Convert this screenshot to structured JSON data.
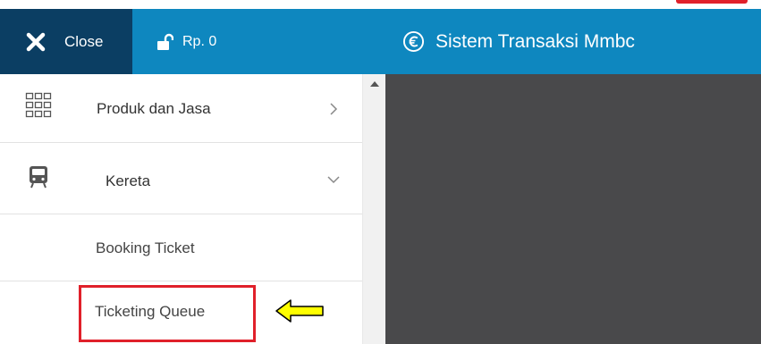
{
  "header": {
    "close_label": "Close",
    "balance_label": "Rp. 0",
    "app_title": "Sistem Transaksi Mmbc"
  },
  "sidebar": {
    "items": [
      {
        "label": "Produk dan Jasa",
        "icon": "grid-icon",
        "chevron": "chevron-right-icon"
      },
      {
        "label": "Kereta",
        "icon": "train-icon",
        "chevron": "chevron-down-icon"
      }
    ],
    "subitems": [
      {
        "label": "Booking Ticket"
      },
      {
        "label": "Ticketing Queue"
      }
    ]
  },
  "annotation": {
    "highlight_color": "#e0202a",
    "arrow_color": "#ffff00"
  },
  "colors": {
    "header_bg": "#0e87bf",
    "close_bg": "#0b3e63",
    "content_bg": "#49494b"
  }
}
